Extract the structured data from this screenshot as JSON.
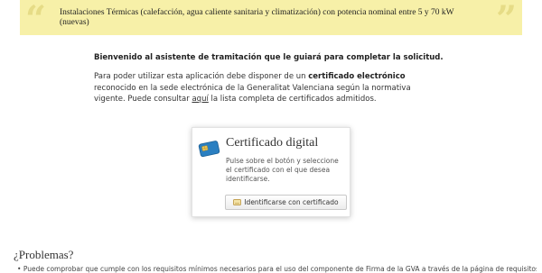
{
  "banner": {
    "text": "Instalaciones Térmicas (calefacción, agua caliente sanitaria y climatización) con potencia nominal entre 5 y 70 kW (nuevas)"
  },
  "intro": {
    "welcome": "Bienvenido al asistente de tramitación que le guiará para completar la solicitud.",
    "p1_before": "Para poder utilizar esta aplicación debe disponer de un ",
    "p1_bold": "certificado electrónico",
    "p1_after": " reconocido en la sede electrónica de la Generalitat Valenciana según la normativa vigente. Puede consultar ",
    "link": "aquí",
    "p1_end": " la lista completa de certificados admitidos."
  },
  "cert_card": {
    "title": "Certificado digital",
    "description": "Pulse sobre el botón y seleccione el certificado con el que desea identificarse.",
    "button_label": "Identificarse con certificado",
    "icon": "smartcard-icon"
  },
  "problems": {
    "title": "¿Problemas?",
    "item1": "Puede comprobar que cumple con los requisitos mínimos necesarios para el uso del componente de Firma de la GVA a través de la página de requisitos"
  }
}
